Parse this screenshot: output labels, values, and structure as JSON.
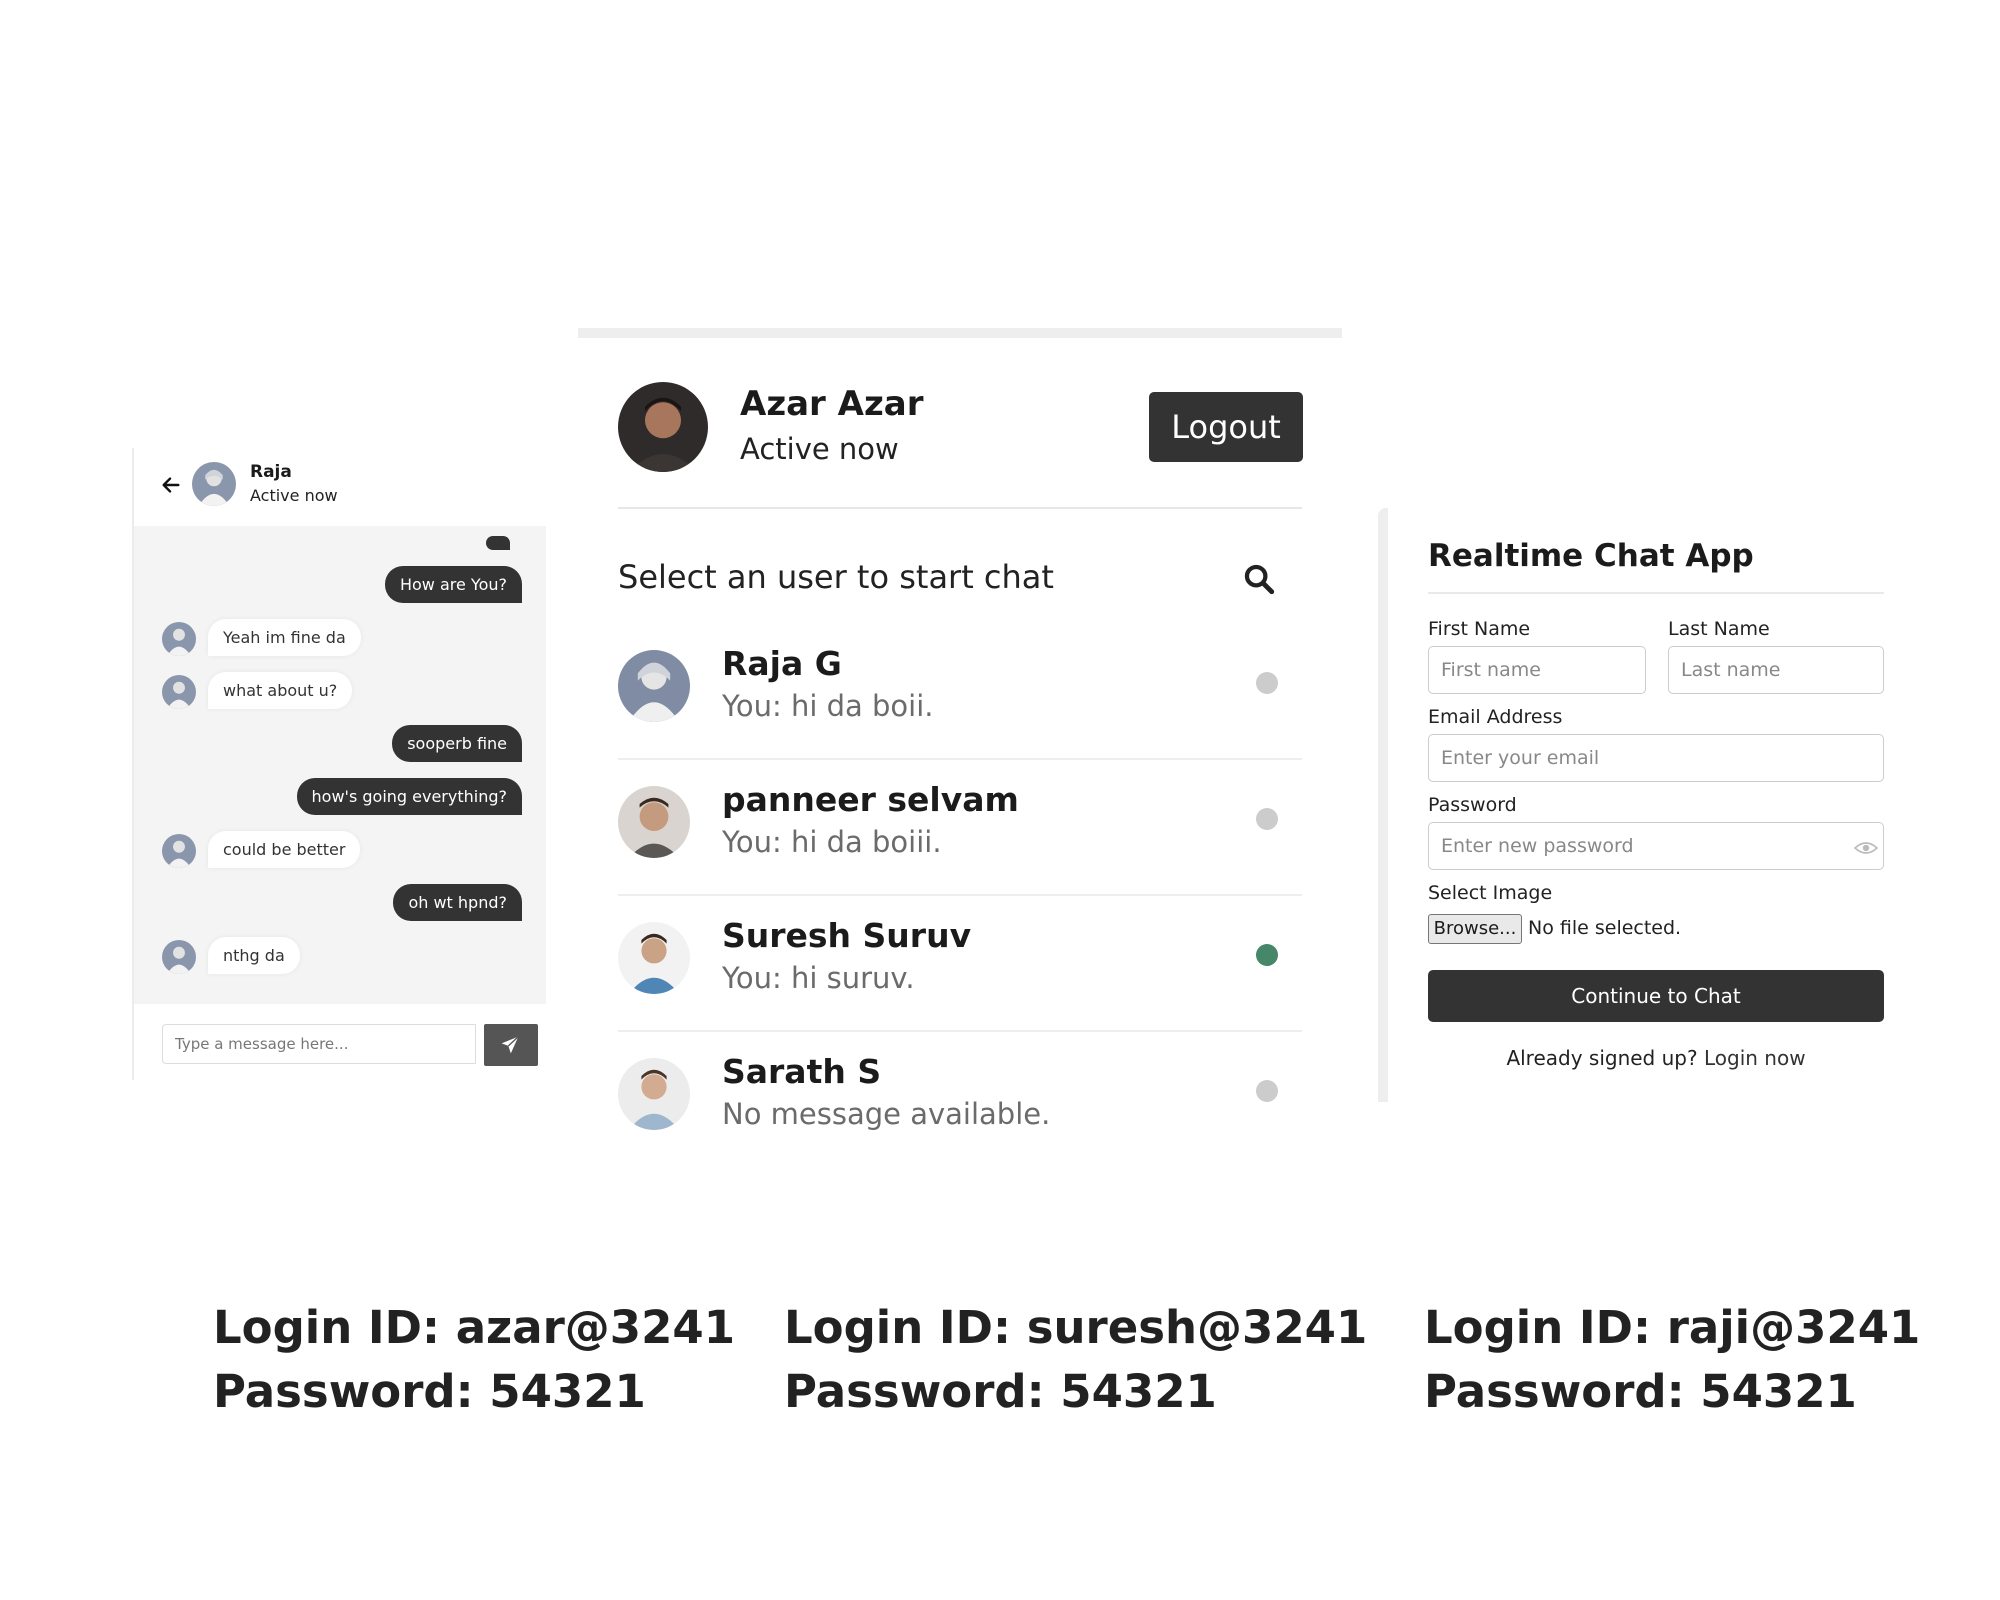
{
  "chat": {
    "contact_name": "Raja",
    "contact_status": "Active now",
    "messages": [
      {
        "from": "me",
        "text": ""
      },
      {
        "from": "me",
        "text": "How are You?"
      },
      {
        "from": "them",
        "text": "Yeah im fine da"
      },
      {
        "from": "them",
        "text": "what about u?"
      },
      {
        "from": "me",
        "text": "sooperb fine"
      },
      {
        "from": "me",
        "text": "how's going everything?"
      },
      {
        "from": "them",
        "text": "could be better"
      },
      {
        "from": "me",
        "text": "oh wt hpnd?"
      },
      {
        "from": "them",
        "text": "nthg da"
      }
    ],
    "input_placeholder": "Type a message here...",
    "input_value": ""
  },
  "users_page": {
    "me": {
      "name": "Azar Azar",
      "status": "Active now"
    },
    "logout_label": "Logout",
    "search_title": "Select an user to start chat",
    "users": [
      {
        "name": "Raja G",
        "last_message": "You: hi da boii.",
        "status": "offline"
      },
      {
        "name": "panneer selvam",
        "last_message": "You: hi da boiii.",
        "status": "offline"
      },
      {
        "name": "Suresh Suruv",
        "last_message": "You: hi suruv.",
        "status": "online"
      },
      {
        "name": "Sarath S",
        "last_message": "No message available.",
        "status": "offline"
      }
    ],
    "colors": {
      "online": "#468669",
      "offline": "#cccccc"
    }
  },
  "signup": {
    "title": "Realtime Chat App",
    "first_name_label": "First Name",
    "first_name_placeholder": "First name",
    "last_name_label": "Last Name",
    "last_name_placeholder": "Last name",
    "email_label": "Email Address",
    "email_placeholder": "Enter your email",
    "password_label": "Password",
    "password_placeholder": "Enter new password",
    "image_label": "Select Image",
    "browse_label": "Browse...",
    "file_status": "No file selected.",
    "submit_label": "Continue to Chat",
    "login_prompt": "Already signed up?",
    "login_link": "Login now"
  },
  "credentials": [
    {
      "login": "Login ID: azar@3241",
      "password": "Password: 54321"
    },
    {
      "login": "Login ID: suresh@3241",
      "password": "Password: 54321"
    },
    {
      "login": "Login ID: raji@3241",
      "password": "Password: 54321"
    }
  ],
  "icons": {
    "back": "arrow-left-icon",
    "send": "paper-plane-icon",
    "search": "search-icon",
    "password_toggle": "eye-icon"
  },
  "theme": {
    "dark": "#333333",
    "chat_bg": "#f4f4f4",
    "online": "#468669"
  }
}
